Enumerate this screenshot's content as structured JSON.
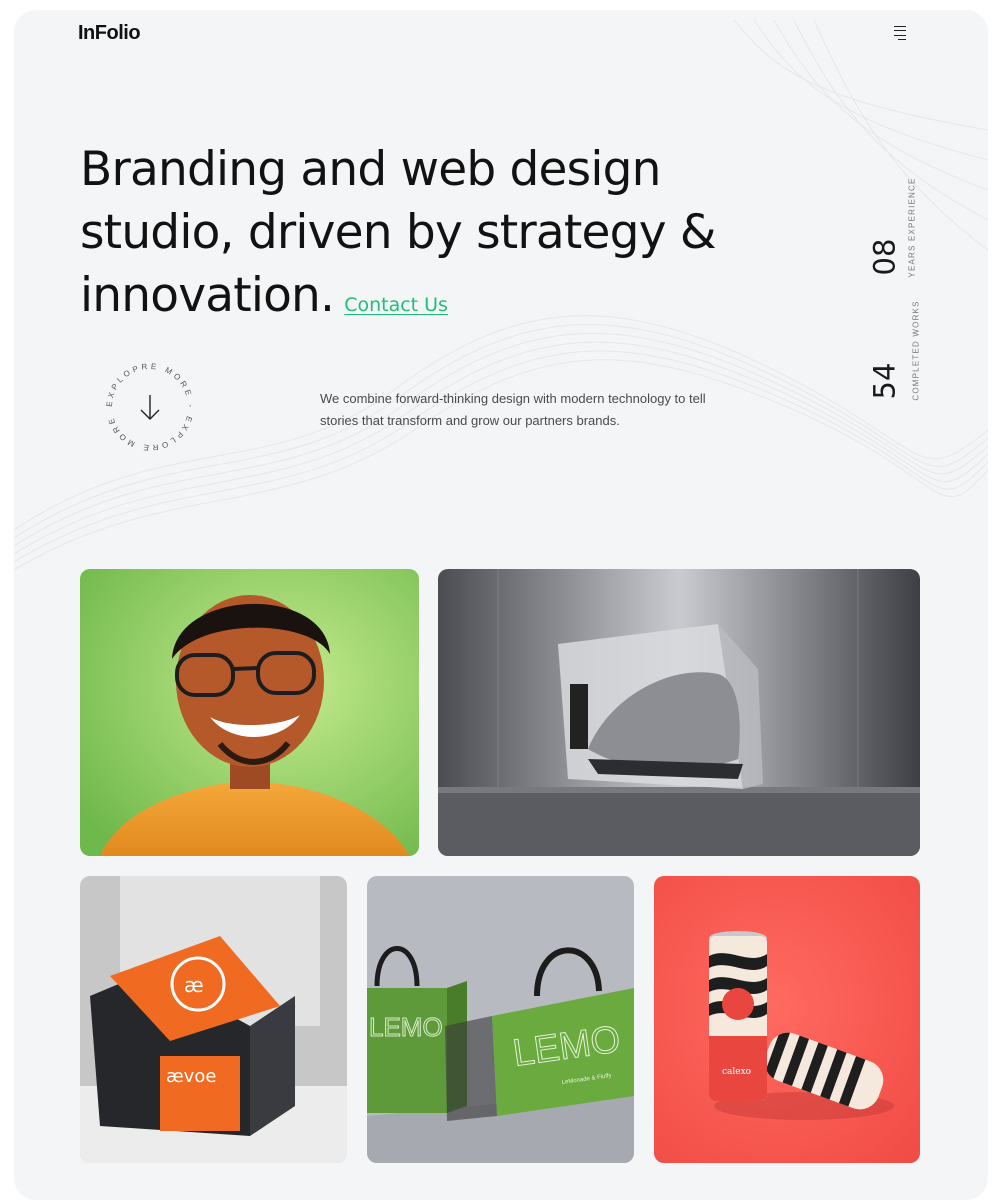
{
  "brand": {
    "logo": "InFolio"
  },
  "nav": {
    "menu_icon": "hamburger-menu-icon"
  },
  "hero": {
    "headline": "Branding and web design studio, driven by strategy & innovation.",
    "contact_link": "Contact Us"
  },
  "explore": {
    "ring_text": "EXPLOPRE MORE - EXPLORE MORE - ",
    "icon": "arrow-down-icon"
  },
  "intro": {
    "text": "We combine forward-thinking design with modern technology to tell stories that transform and grow our partners brands."
  },
  "stats": [
    {
      "value": "08",
      "label": "YEARS EXPERIENCE"
    },
    {
      "value": "54",
      "label": "COMPLETED WORKS"
    }
  ],
  "portfolio": {
    "items": [
      {
        "subject": "smiling-man-portrait"
      },
      {
        "subject": "sneaker-glass-box"
      },
      {
        "subject": "aevoe-packaging",
        "brand_text": "ævoe"
      },
      {
        "subject": "lemonade-bags",
        "brand_text": "LEMO",
        "sub_text": "LeMonade & Fluffy"
      },
      {
        "subject": "striped-cans",
        "brand_text": "calexo"
      }
    ]
  },
  "colors": {
    "accent": "#1fbf7a",
    "background": "#f4f5f7",
    "text": "#121212"
  }
}
